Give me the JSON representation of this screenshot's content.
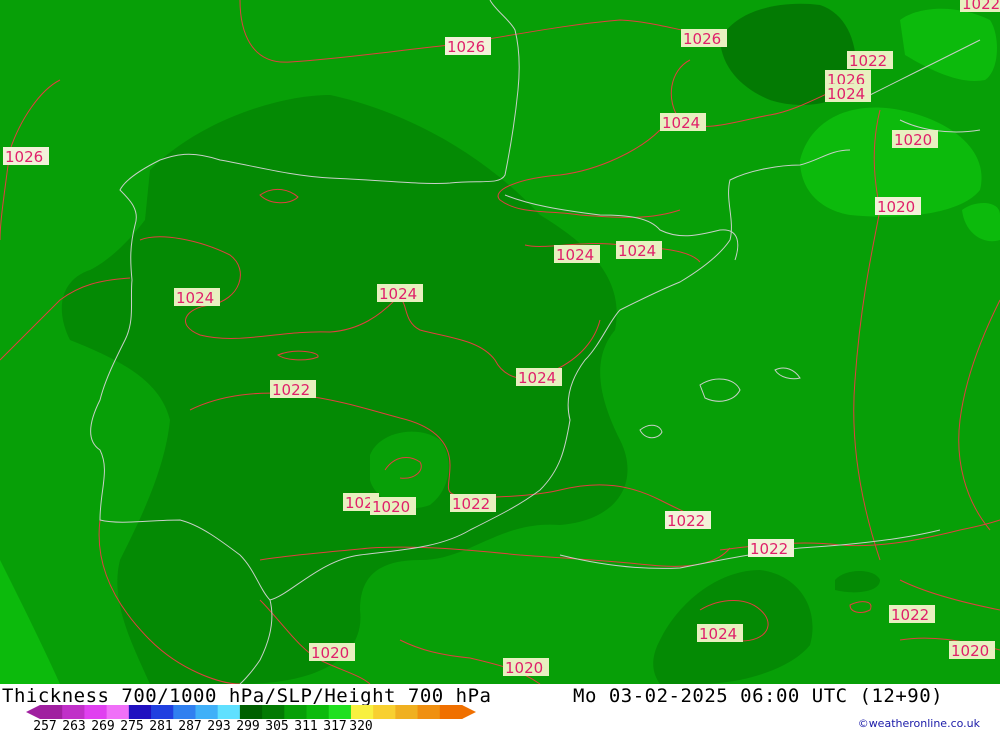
{
  "map": {
    "colors": {
      "field_light": "#079f07",
      "field_mid": "#048a04",
      "field_dark": "#037a03",
      "field_bright": "#0cba0c",
      "isobar": "#e04040",
      "coast": "#c8d0c8",
      "label_bg_high": "#f2f2d8",
      "label_bg_mid": "#e8f0c0"
    },
    "isobar_labels": [
      {
        "text": "1026"
      },
      {
        "text": "1026"
      },
      {
        "text": "1026"
      },
      {
        "text": "1022"
      },
      {
        "text": "1022"
      },
      {
        "text": "1026"
      },
      {
        "text": "1024"
      },
      {
        "text": "1024"
      },
      {
        "text": "1020"
      },
      {
        "text": "1020"
      },
      {
        "text": "1024"
      },
      {
        "text": "1024"
      },
      {
        "text": "1024"
      },
      {
        "text": "1024"
      },
      {
        "text": "1024"
      },
      {
        "text": "1022"
      },
      {
        "text": "102"
      },
      {
        "text": "1020"
      },
      {
        "text": "1022"
      },
      {
        "text": "1022"
      },
      {
        "text": "1022"
      },
      {
        "text": "1024"
      },
      {
        "text": "1022"
      },
      {
        "text": "1020"
      },
      {
        "text": "1020"
      },
      {
        "text": "1020"
      }
    ]
  },
  "footer": {
    "title_left": "Thickness 700/1000 hPa/SLP/Height 700 hPa",
    "title_right": "Mo 03-02-2025 06:00 UTC (12+90)",
    "credit": "©weatheronline.co.uk",
    "legend_colors": [
      "#a020a0",
      "#c030c8",
      "#e040f0",
      "#f070f8",
      "#2010c0",
      "#2040e0",
      "#3080f0",
      "#40b0f8",
      "#60e0ff",
      "#006000",
      "#037a03",
      "#079f07",
      "#0cba0c",
      "#20e020",
      "#f8f040",
      "#f8d030",
      "#f0b020",
      "#f09010",
      "#f07000"
    ],
    "legend_ticks": [
      "257",
      "263",
      "269",
      "275",
      "281",
      "287",
      "293",
      "299",
      "305",
      "311",
      "317",
      "320"
    ]
  }
}
